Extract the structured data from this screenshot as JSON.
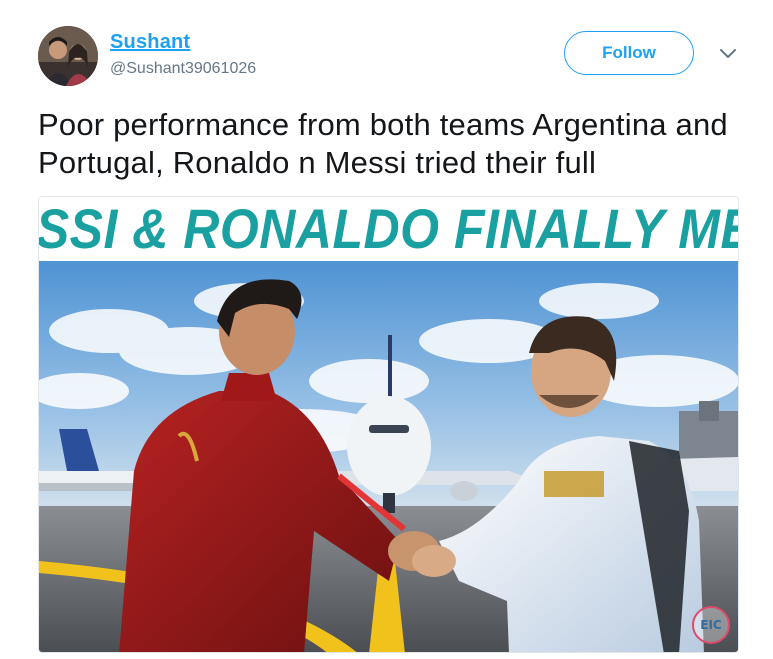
{
  "user": {
    "display_name": "Sushant",
    "handle": "@Sushant39061026",
    "follow_label": "Follow"
  },
  "tweet": {
    "text": "Poor performance from both teams Argentina and Portugal, Ronaldo n Messi tried their full"
  },
  "media": {
    "banner": "MESSI & RONALDO FINALLY MEET",
    "watermark": "EIC"
  },
  "colors": {
    "link": "#1da1f2",
    "banner_text": "#1aa0a0"
  },
  "icons": {
    "caret": "chevron-down-icon"
  }
}
